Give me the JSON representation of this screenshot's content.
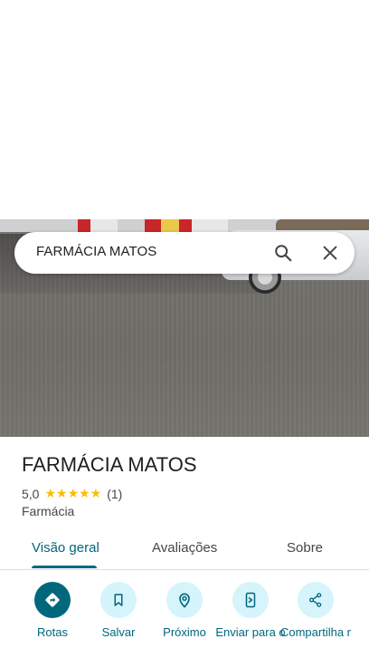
{
  "search": {
    "query": "FARMÁCIA MATOS"
  },
  "place": {
    "name": "FARMÁCIA MATOS",
    "rating": "5,0",
    "stars": "★★★★★",
    "review_count": "(1)",
    "category": "Farmácia"
  },
  "tabs": [
    {
      "label": "Visão geral"
    },
    {
      "label": "Avaliações"
    },
    {
      "label": "Sobre"
    }
  ],
  "actions": [
    {
      "label": "Rotas",
      "icon": "directions-icon"
    },
    {
      "label": "Salvar",
      "icon": "bookmark-icon"
    },
    {
      "label": "Próximo",
      "icon": "nearby-icon"
    },
    {
      "label": "Enviar para o",
      "icon": "send-to-phone-icon"
    },
    {
      "label": "Compartilha r",
      "icon": "share-icon"
    }
  ],
  "colors": {
    "accent": "#00677d",
    "accent_light": "#d6f4fb",
    "star": "#fbbc04"
  }
}
